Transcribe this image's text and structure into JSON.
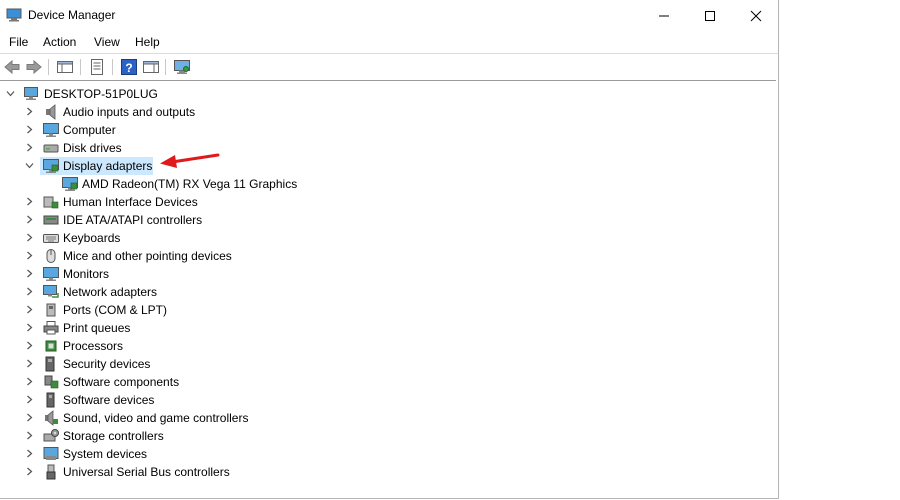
{
  "window": {
    "title": "Device Manager"
  },
  "menu": [
    "File",
    "Action",
    "View",
    "Help"
  ],
  "tree": {
    "root": "DESKTOP-51P0LUG",
    "categories": [
      {
        "label": "Audio inputs and outputs",
        "icon": "speaker-icon"
      },
      {
        "label": "Computer",
        "icon": "monitor-icon"
      },
      {
        "label": "Disk drives",
        "icon": "disk-drive-icon"
      },
      {
        "label": "Display adapters",
        "icon": "display-adapter-icon",
        "expanded": true,
        "selected": true,
        "children": [
          "AMD Radeon(TM) RX Vega 11 Graphics"
        ]
      },
      {
        "label": "Human Interface Devices",
        "icon": "hid-icon"
      },
      {
        "label": "IDE ATA/ATAPI controllers",
        "icon": "ide-controller-icon"
      },
      {
        "label": "Keyboards",
        "icon": "keyboard-icon"
      },
      {
        "label": "Mice and other pointing devices",
        "icon": "mouse-icon"
      },
      {
        "label": "Monitors",
        "icon": "monitor-icon"
      },
      {
        "label": "Network adapters",
        "icon": "network-adapter-icon"
      },
      {
        "label": "Ports (COM & LPT)",
        "icon": "port-icon"
      },
      {
        "label": "Print queues",
        "icon": "printer-icon"
      },
      {
        "label": "Processors",
        "icon": "processor-icon"
      },
      {
        "label": "Security devices",
        "icon": "security-device-icon"
      },
      {
        "label": "Software components",
        "icon": "software-component-icon"
      },
      {
        "label": "Software devices",
        "icon": "software-device-icon"
      },
      {
        "label": "Sound, video and game controllers",
        "icon": "sound-controller-icon"
      },
      {
        "label": "Storage controllers",
        "icon": "storage-controller-icon"
      },
      {
        "label": "System devices",
        "icon": "system-device-icon"
      },
      {
        "label": "Universal Serial Bus controllers",
        "icon": "usb-icon"
      }
    ]
  },
  "colors": {
    "selection": "#cce8ff",
    "annotation_arrow": "#e0191b"
  }
}
